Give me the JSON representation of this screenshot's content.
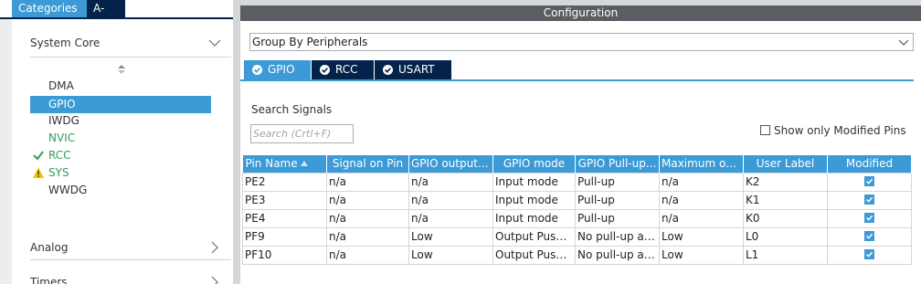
{
  "left_panel": {
    "tabs": [
      "Categories",
      "A->Z"
    ],
    "categories": [
      {
        "label": "System Core",
        "expanded": true,
        "items": [
          {
            "label": "DMA",
            "status": "none"
          },
          {
            "label": "GPIO",
            "status": "selected"
          },
          {
            "label": "IWDG",
            "status": "none"
          },
          {
            "label": "NVIC",
            "status": "configured"
          },
          {
            "label": "RCC",
            "status": "ok"
          },
          {
            "label": "SYS",
            "status": "warning"
          },
          {
            "label": "WWDG",
            "status": "none"
          }
        ]
      },
      {
        "label": "Analog",
        "expanded": false
      },
      {
        "label": "Timers",
        "expanded": false
      }
    ]
  },
  "config": {
    "title": "Configuration",
    "group_by": "Group By Peripherals",
    "tabs": [
      "GPIO",
      "RCC",
      "USART"
    ],
    "active_tab": "GPIO",
    "search_label": "Search Signals",
    "search_placeholder": "Search (Crtl+F)",
    "show_modified_label": "Show only Modified Pins",
    "show_modified_checked": false
  },
  "table": {
    "columns": [
      "Pin Name",
      "Signal on Pin",
      "GPIO output ...",
      "GPIO mode",
      "GPIO Pull-up...",
      "Maximum ou...",
      "User Label",
      "Modified"
    ],
    "rows": [
      {
        "pin": "PE2",
        "signal": "n/a",
        "output": "n/a",
        "mode": "Input mode",
        "pull": "Pull-up",
        "max": "n/a",
        "label": "K2",
        "modified": true
      },
      {
        "pin": "PE3",
        "signal": "n/a",
        "output": "n/a",
        "mode": "Input mode",
        "pull": "Pull-up",
        "max": "n/a",
        "label": "K1",
        "modified": true
      },
      {
        "pin": "PE4",
        "signal": "n/a",
        "output": "n/a",
        "mode": "Input mode",
        "pull": "Pull-up",
        "max": "n/a",
        "label": "K0",
        "modified": true
      },
      {
        "pin": "PF9",
        "signal": "n/a",
        "output": "Low",
        "mode": "Output Push...",
        "pull": "No pull-up an...",
        "max": "Low",
        "label": "L0",
        "modified": true
      },
      {
        "pin": "PF10",
        "signal": "n/a",
        "output": "Low",
        "mode": "Output Push...",
        "pull": "No pull-up an...",
        "max": "Low",
        "label": "L1",
        "modified": true
      }
    ]
  },
  "colors": {
    "accent": "#3c9bd6",
    "navy": "#03234b",
    "green": "#2f9c5a",
    "warning": "#f4c400",
    "header_gray": "#5a5d61"
  },
  "icons": {
    "collapse": "chevron-down-icon",
    "expand": "chevron-right-icon",
    "sort": "sort-icon",
    "ok": "check-icon",
    "warning": "warning-icon",
    "tab_status": "check-circle-icon",
    "modified": "checkbox-checked-icon"
  }
}
